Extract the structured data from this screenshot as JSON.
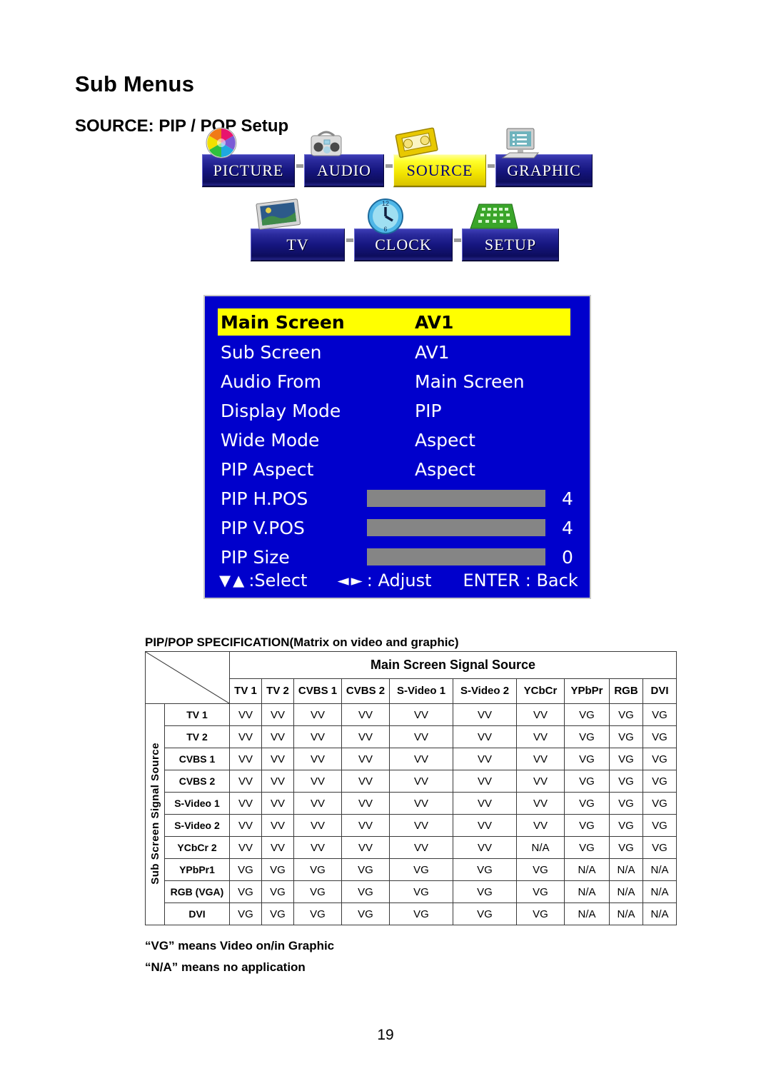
{
  "page_title": "Sub Menus",
  "section_title": "SOURCE: PIP / POP Setup",
  "page_number": "19",
  "menubar": {
    "row1": [
      {
        "label": "PICTURE",
        "icon": "color-wheel-icon",
        "active": false
      },
      {
        "label": "AUDIO",
        "icon": "boombox-icon",
        "active": false
      },
      {
        "label": "SOURCE",
        "icon": "vhs-cassette-icon",
        "active": true
      },
      {
        "label": "GRAPHIC",
        "icon": "computer-icon",
        "active": false
      }
    ],
    "row2": [
      {
        "label": "TV",
        "icon": "television-icon",
        "active": false
      },
      {
        "label": "CLOCK",
        "icon": "clock-icon",
        "active": false
      },
      {
        "label": "SETUP",
        "icon": "keyboard-icon",
        "active": false
      }
    ]
  },
  "osd": {
    "background_color": "#0000CC",
    "highlight_color": "#FFFF00",
    "slider_fill_color": "#00E800",
    "slider_track_color": "#858585",
    "rows": [
      {
        "label": "Main Screen",
        "value": "AV1",
        "type": "option",
        "highlighted": true
      },
      {
        "label": "Sub Screen",
        "value": "AV1",
        "type": "option",
        "highlighted": false
      },
      {
        "label": "Audio From",
        "value": "Main Screen",
        "type": "option",
        "highlighted": false
      },
      {
        "label": "Display Mode",
        "value": "PIP",
        "type": "option",
        "highlighted": false
      },
      {
        "label": "Wide Mode",
        "value": "Aspect",
        "type": "option",
        "highlighted": false
      },
      {
        "label": "PIP Aspect",
        "value": "Aspect",
        "type": "option",
        "highlighted": false
      },
      {
        "label": "PIP H.POS",
        "value": "4",
        "type": "slider",
        "fill_percent": 8
      },
      {
        "label": "PIP V.POS",
        "value": "4",
        "type": "slider",
        "fill_percent": 8
      },
      {
        "label": "PIP Size",
        "value": "0",
        "type": "slider",
        "fill_percent": 0
      }
    ],
    "footer": {
      "select_glyph": "▼▲",
      "select_text": ":Select",
      "adjust_glyph": "◄►",
      "adjust_text": ": Adjust",
      "back_text": "ENTER : Back"
    }
  },
  "spec_table": {
    "caption": "PIP/POP SPECIFICATION(Matrix on video and graphic)",
    "column_group_header": "Main Screen Signal Source",
    "row_group_header": "Sub Screen Signal Source",
    "columns": [
      "TV 1",
      "TV 2",
      "CVBS 1",
      "CVBS 2",
      "S-Video 1",
      "S-Video 2",
      "YCbCr",
      "YPbPr",
      "RGB",
      "DVI"
    ],
    "rows": [
      {
        "label": "TV 1",
        "cells": [
          "VV",
          "VV",
          "VV",
          "VV",
          "VV",
          "VV",
          "VV",
          "VG",
          "VG",
          "VG"
        ]
      },
      {
        "label": "TV 2",
        "cells": [
          "VV",
          "VV",
          "VV",
          "VV",
          "VV",
          "VV",
          "VV",
          "VG",
          "VG",
          "VG"
        ]
      },
      {
        "label": "CVBS 1",
        "cells": [
          "VV",
          "VV",
          "VV",
          "VV",
          "VV",
          "VV",
          "VV",
          "VG",
          "VG",
          "VG"
        ]
      },
      {
        "label": "CVBS 2",
        "cells": [
          "VV",
          "VV",
          "VV",
          "VV",
          "VV",
          "VV",
          "VV",
          "VG",
          "VG",
          "VG"
        ]
      },
      {
        "label": "S-Video 1",
        "cells": [
          "VV",
          "VV",
          "VV",
          "VV",
          "VV",
          "VV",
          "VV",
          "VG",
          "VG",
          "VG"
        ]
      },
      {
        "label": "S-Video 2",
        "cells": [
          "VV",
          "VV",
          "VV",
          "VV",
          "VV",
          "VV",
          "VV",
          "VG",
          "VG",
          "VG"
        ]
      },
      {
        "label": "YCbCr 2",
        "cells": [
          "VV",
          "VV",
          "VV",
          "VV",
          "VV",
          "VV",
          "N/A",
          "VG",
          "VG",
          "VG"
        ]
      },
      {
        "label": "YPbPr1",
        "cells": [
          "VG",
          "VG",
          "VG",
          "VG",
          "VG",
          "VG",
          "VG",
          "N/A",
          "N/A",
          "N/A"
        ]
      },
      {
        "label": "RGB (VGA)",
        "cells": [
          "VG",
          "VG",
          "VG",
          "VG",
          "VG",
          "VG",
          "VG",
          "N/A",
          "N/A",
          "N/A"
        ]
      },
      {
        "label": "DVI",
        "cells": [
          "VG",
          "VG",
          "VG",
          "VG",
          "VG",
          "VG",
          "VG",
          "N/A",
          "N/A",
          "N/A"
        ]
      }
    ]
  },
  "footnotes": [
    "“VG” means Video on/in Graphic",
    "“N/A” means no application"
  ]
}
